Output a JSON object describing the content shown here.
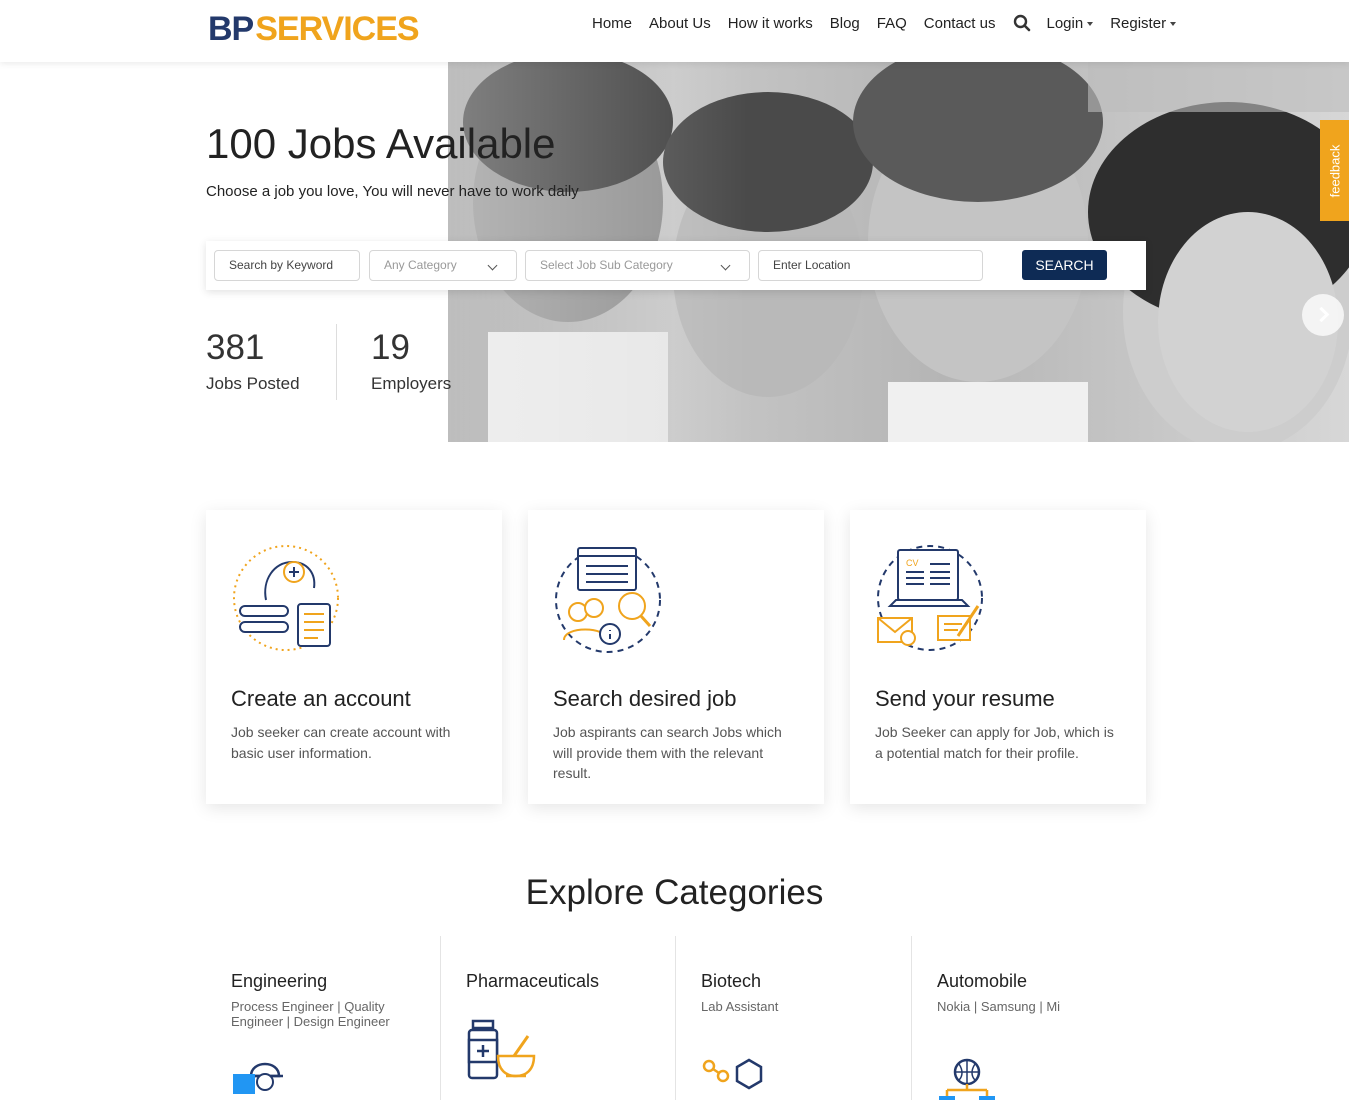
{
  "brand": {
    "logo_left": "BP",
    "logo_right": "SERVICES",
    "accent": "#f0a41d",
    "navy": "#23396b"
  },
  "nav": {
    "items": [
      "Home",
      "About Us",
      "How it works",
      "Blog",
      "FAQ",
      "Contact us"
    ],
    "login": "Login",
    "register": "Register"
  },
  "hero": {
    "title": "100 Jobs Available",
    "subtitle": "Choose a job you love, You will never have to work daily"
  },
  "search": {
    "keyword_placeholder": "Search by Keyword",
    "category": "Any Category",
    "subcategory": "Select Job Sub Category",
    "location_placeholder": "Enter Location",
    "button": "SEARCH",
    "button_color": "#0e2b55"
  },
  "stats": [
    {
      "value": "381",
      "label": "Jobs Posted"
    },
    {
      "value": "19",
      "label": "Employers"
    }
  ],
  "feedback_label": "feedback",
  "steps": [
    {
      "icon": "account-profile-icon",
      "title": "Create an account",
      "text": "Job seeker can create account with basic user information."
    },
    {
      "icon": "job-search-icon",
      "title": "Search desired job",
      "text": "Job aspirants can search Jobs which will provide them with the relevant result."
    },
    {
      "icon": "resume-laptop-icon",
      "title": "Send your resume",
      "text": "Job Seeker can apply for Job, which is a potential match for their profile."
    }
  ],
  "categories": {
    "title": "Explore Categories",
    "items": [
      {
        "name": "Engineering",
        "subs": "Process Engineer | Quality Engineer | Design Engineer",
        "icon": "engineer-icon"
      },
      {
        "name": "Pharmaceuticals",
        "subs": "",
        "icon": "medicine-icon"
      },
      {
        "name": "Biotech",
        "subs": "Lab Assistant",
        "icon": "molecule-icon"
      },
      {
        "name": "Automobile",
        "subs": "Nokia | Samsung | Mi",
        "icon": "network-globe-icon"
      }
    ]
  }
}
